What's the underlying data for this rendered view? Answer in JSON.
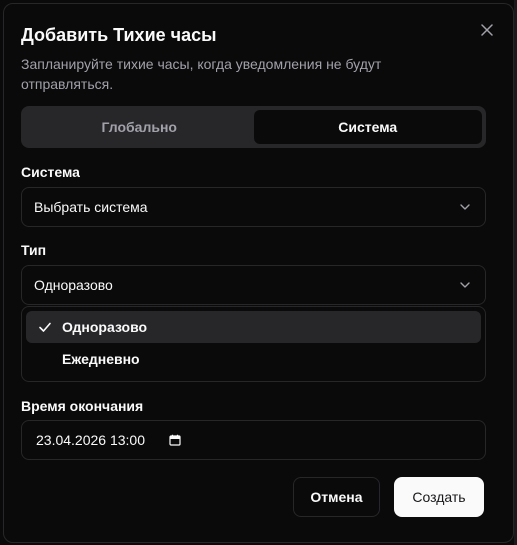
{
  "dialog": {
    "title": "Добавить Тихие часы",
    "description": "Запланируйте тихие часы, когда уведомления не будут отправляться.",
    "close_icon": "close-icon"
  },
  "tabs": [
    {
      "label": "Глобально",
      "active": false
    },
    {
      "label": "Система",
      "active": true
    }
  ],
  "system_field": {
    "label": "Система",
    "value": "Выбрать система",
    "icon": "chevron-down-icon"
  },
  "type_field": {
    "label": "Тип",
    "value": "Одноразово",
    "icon": "chevron-down-icon",
    "options": [
      {
        "label": "Одноразово",
        "selected": true
      },
      {
        "label": "Ежедневно",
        "selected": false
      }
    ]
  },
  "end_time_field": {
    "label": "Время окончания",
    "value": "23.04.2026 13:00",
    "icon": "calendar-icon"
  },
  "footer": {
    "cancel_label": "Отмена",
    "create_label": "Создать"
  },
  "colors": {
    "background": "#0a0a0a",
    "border": "#27272a",
    "muted_text": "#a1a1aa",
    "primary_button_bg": "#fafafa"
  }
}
